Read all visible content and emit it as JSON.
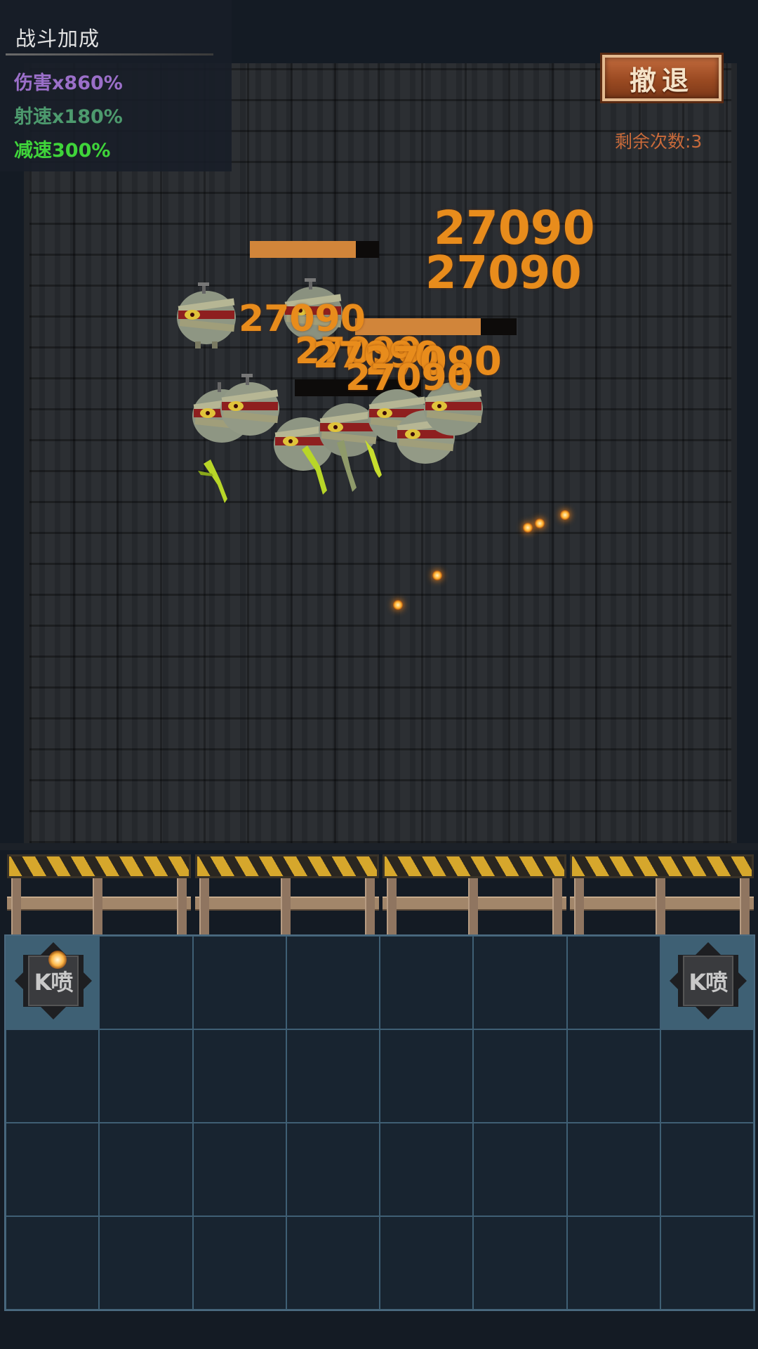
{
  "bonus": {
    "title": "战斗加成",
    "items": [
      {
        "label": "伤害x860%",
        "color": "#9b6fc9"
      },
      {
        "label": "射速x180%",
        "color": "#4d9a6e"
      },
      {
        "label": "减速300%",
        "color": "#3fd43a"
      }
    ]
  },
  "retreat_label": "撤退",
  "remaining_label": "剩余次数:3",
  "damage_numbers": [
    "27090",
    "27090",
    "27090",
    "27090",
    "27090",
    "27090",
    "27090"
  ],
  "hp_bars": [
    0.82,
    0.78,
    0.0
  ],
  "turrets": [
    {
      "label": "K喷",
      "icon": "turret-icon"
    },
    {
      "label": "K喷",
      "icon": "turret-icon"
    }
  ],
  "colors": {
    "damage": "#e88c1c",
    "retreat_button": "#9a4a22",
    "remaining_text": "#c96a3a",
    "grid_line": "#4b6a80"
  }
}
